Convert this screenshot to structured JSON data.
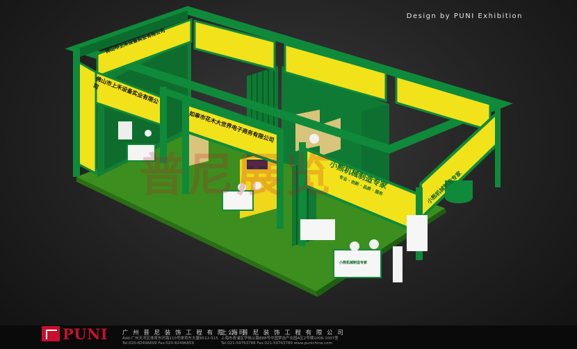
{
  "header": {
    "credit": "Design by PUNI Exhibition"
  },
  "booth": {
    "fascia_left_top": "佛山市上禾设备实业有限公司",
    "fascia_left_front": "佛山市上禾设备实业有限公司",
    "fascia_middle": "如皋市花木大世界电子商务有限公司",
    "fascia_right": "小熊机械制造专家",
    "fascia_right_sub": "专业 · 创新 · 品质 · 服务",
    "fascia_right_end": "小熊机械制造专家",
    "counter_label_right": "小熊机械制造专家",
    "watermark": "普尼展览"
  },
  "footer": {
    "logo_text": "PUNI",
    "guangzhou": {
      "company": "广 州 普 尼 装 饰 工 程 有 限 公 司",
      "address": "Add:广州天河区体育东环路110号体育东大厦B512-515",
      "phone": "Tel:020-82496899     Fax:020-82496859"
    },
    "shanghai": {
      "company": "上 海 普 尼 装 饰 工 程 有 限 公 司",
      "address": "上海市青浦区华徐公路888号中国梦谷产业园A区2号楼1006-1007室",
      "phone": "Tel:021-59763788     Fax:021-59763789     www.punichina.com"
    }
  },
  "colors": {
    "frame_green": "#0f8a3a",
    "panel_yellow": "#f2e21a",
    "floor_green": "#3c8f1e",
    "brand_red": "#c8102e"
  }
}
